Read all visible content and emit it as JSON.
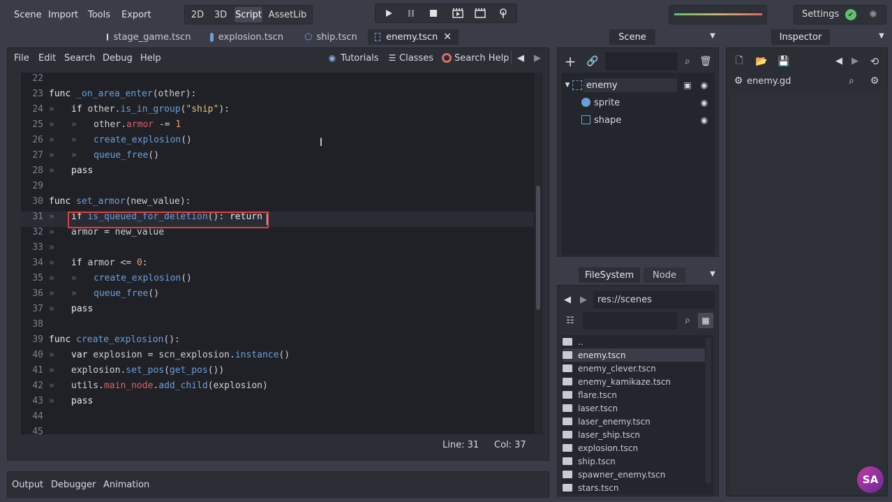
{
  "topbar": {
    "menus": [
      "Scene",
      "Import",
      "Tools",
      "Export"
    ],
    "modes": [
      "2D",
      "3D",
      "Script",
      "AssetLib"
    ],
    "active_mode": "Script",
    "play_icons": [
      "play-icon",
      "pause-icon",
      "stop-icon",
      "play-scene-icon",
      "play-custom-icon",
      "remote-debug-icon"
    ],
    "settings_label": "Settings"
  },
  "tabs": [
    {
      "label": "stage_game.tscn",
      "icon": "circle-icon",
      "active": false
    },
    {
      "label": "explosion.tscn",
      "icon": "sprite-icon",
      "active": false
    },
    {
      "label": "ship.tscn",
      "icon": "polygon-icon",
      "active": false
    },
    {
      "label": "enemy.tscn",
      "icon": "area-icon",
      "active": true
    }
  ],
  "script_menu": {
    "items": [
      "File",
      "Edit",
      "Search",
      "Debug",
      "Help"
    ],
    "tutorials": "Tutorials",
    "classes": "Classes",
    "search_help": "Search Help"
  },
  "code": {
    "lines": [
      {
        "n": "22",
        "t": ""
      },
      {
        "n": "23",
        "t": "func _on_area_enter(other):"
      },
      {
        "n": "24",
        "t": "if other.is_in_group(\"ship\"):"
      },
      {
        "n": "25",
        "t": "other.armor -= 1"
      },
      {
        "n": "26",
        "t": "create_explosion()"
      },
      {
        "n": "27",
        "t": "queue_free()"
      },
      {
        "n": "28",
        "t": "pass"
      },
      {
        "n": "29",
        "t": ""
      },
      {
        "n": "30",
        "t": "func set_armor(new_value):"
      },
      {
        "n": "31",
        "t": "if is_queued_for_deletion(): return"
      },
      {
        "n": "32",
        "t": "armor = new_value"
      },
      {
        "n": "33",
        "t": ""
      },
      {
        "n": "34",
        "t": "if armor <= 0:"
      },
      {
        "n": "35",
        "t": "create_explosion()"
      },
      {
        "n": "36",
        "t": "queue_free()"
      },
      {
        "n": "37",
        "t": "pass"
      },
      {
        "n": "38",
        "t": ""
      },
      {
        "n": "39",
        "t": "func create_explosion():"
      },
      {
        "n": "40",
        "t": "var explosion = scn_explosion.instance()"
      },
      {
        "n": "41",
        "t": "explosion.set_pos(get_pos())"
      },
      {
        "n": "42",
        "t": "utils.main_node.add_child(explosion)"
      },
      {
        "n": "43",
        "t": "pass"
      },
      {
        "n": "44",
        "t": ""
      },
      {
        "n": "45",
        "t": ""
      }
    ],
    "line_status": "Line: 31",
    "col_status": "Col: 37"
  },
  "bottom_tabs": [
    "Output",
    "Debugger",
    "Animation"
  ],
  "scene_dock": {
    "tab": "Scene",
    "tree": [
      {
        "label": "enemy",
        "icon": "area-icon",
        "root": true
      },
      {
        "label": "sprite",
        "icon": "sprite-icon"
      },
      {
        "label": "shape",
        "icon": "shape-icon"
      }
    ]
  },
  "filesystem_dock": {
    "tabs": [
      "FileSystem",
      "Node"
    ],
    "path": "res://scenes",
    "files": [
      "..",
      "enemy.tscn",
      "enemy_clever.tscn",
      "enemy_kamikaze.tscn",
      "flare.tscn",
      "laser.tscn",
      "laser_enemy.tscn",
      "laser_ship.tscn",
      "explosion.tscn",
      "ship.tscn",
      "spawner_enemy.tscn",
      "stars.tscn"
    ],
    "selected": "enemy.tscn"
  },
  "inspector": {
    "tab": "Inspector",
    "resource": "enemy.gd"
  },
  "colors": {
    "accent": "#6c9fd8",
    "highlight": "#e0403c",
    "bg": "#3a3c47"
  }
}
